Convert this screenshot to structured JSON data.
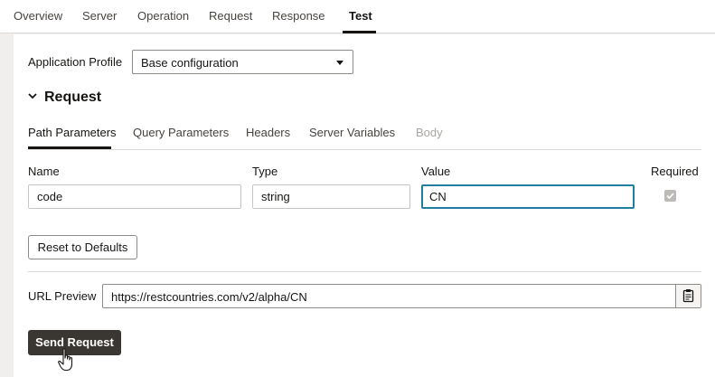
{
  "nav": {
    "tabs": [
      "Overview",
      "Server",
      "Operation",
      "Request",
      "Response",
      "Test"
    ],
    "active": "Test"
  },
  "profile": {
    "label": "Application Profile",
    "selected": "Base configuration"
  },
  "request": {
    "title": "Request",
    "tabs": [
      "Path Parameters",
      "Query Parameters",
      "Headers",
      "Server Variables",
      "Body"
    ],
    "active_tab": "Path Parameters",
    "disabled_tab": "Body"
  },
  "params": {
    "headers": {
      "name": "Name",
      "type": "Type",
      "value": "Value",
      "required": "Required"
    },
    "row": {
      "name": "code",
      "type": "string",
      "value": "CN",
      "required": true
    }
  },
  "reset_label": "Reset to Defaults",
  "url_preview": {
    "label": "URL Preview",
    "value": "https://restcountries.com/v2/alpha/CN"
  },
  "send_label": "Send Request",
  "colors": {
    "accent_focus": "#227e9e",
    "primary_button": "#3a3632",
    "background": "#f1efed"
  },
  "icons": [
    "chevron-down-icon",
    "caret-down-icon",
    "check-icon",
    "clipboard-icon",
    "hand-pointer-icon"
  ]
}
